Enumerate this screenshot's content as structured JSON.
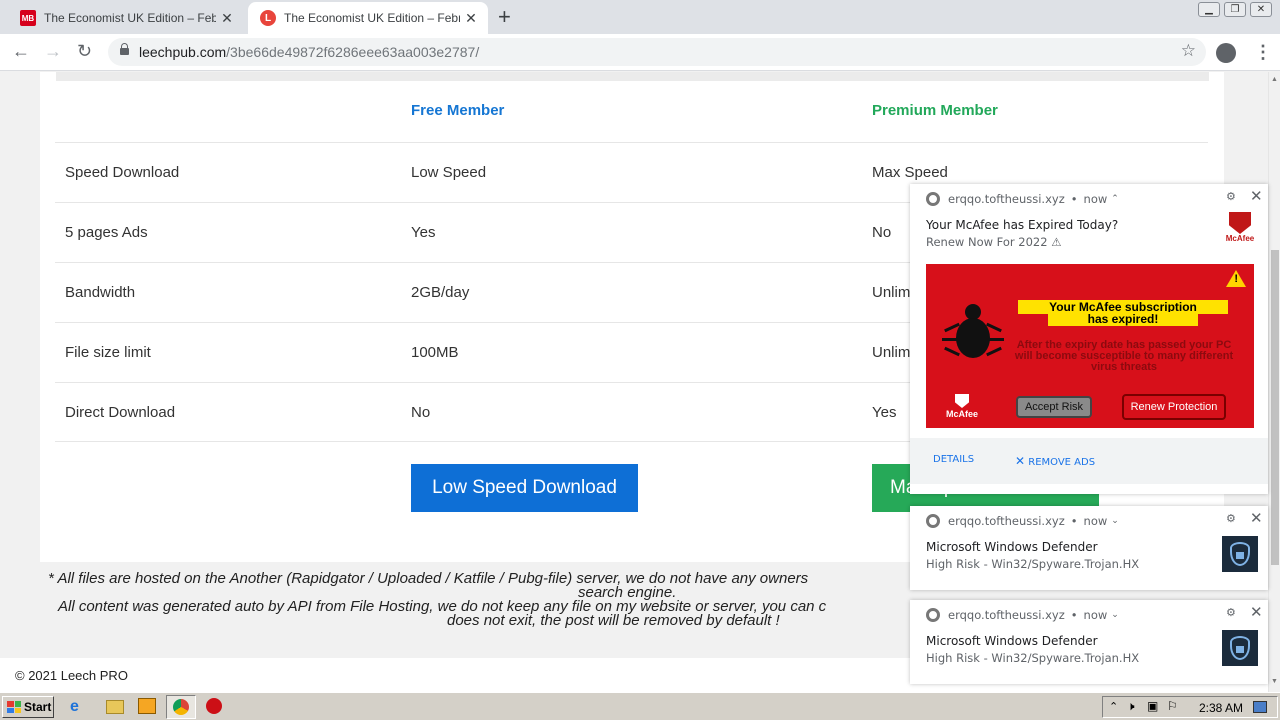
{
  "browser": {
    "tabs": [
      {
        "favicon": "MB",
        "title": "The Economist UK Edition – February"
      },
      {
        "favicon": "L",
        "title": "The Economist UK Edition – February"
      }
    ],
    "url_host": "leechpub.com",
    "url_path": "/3be66de49872f6286eee63aa003e2787/"
  },
  "table": {
    "headers": [
      "Free Member",
      "Premium Member"
    ],
    "rows": [
      [
        "Speed Download",
        "Low Speed",
        "Max Speed"
      ],
      [
        "5 pages Ads",
        "Yes",
        "No"
      ],
      [
        "Bandwidth",
        "2GB/day",
        "Unlim"
      ],
      [
        "File size limit",
        "100MB",
        "Unlim"
      ],
      [
        "Direct Download",
        "No",
        "Yes"
      ]
    ],
    "low_button": "Low Speed Download",
    "max_button": "Max Speed Download"
  },
  "notes": {
    "line1": "* All files are hosted on the Another (Rapidgator / Uploaded / Katfile / Pubg-file) server, we do not have any owners",
    "line1b": "search engine.",
    "line2": "All content was generated auto by API from File Hosting, we do not keep any file on my website or server, you can c",
    "line2b": "does not exit, the post will be removed by default !"
  },
  "footer": "© 2021 Leech PRO",
  "notifications": [
    {
      "source": "erqqo.toftheussi.xyz",
      "time": "now",
      "title": "Your McAfee has Expired Today?",
      "message": "Renew Now For 2022 ⚠",
      "icon_label": "McAfee",
      "banner": {
        "title1": "Your McAfee subscription",
        "title2": "has expired!",
        "body": "After the expiry date has passed your PC will become susceptible to many different virus threats",
        "logo": "McAfee",
        "accept": "Accept Risk",
        "renew": "Renew Protection"
      },
      "actions": [
        "DETAILS",
        "REMOVE ADS"
      ]
    },
    {
      "source": "erqqo.toftheussi.xyz",
      "time": "now",
      "title": "Microsoft Windows Defender",
      "message": "High Risk - Win32/Spyware.Trojan.HX"
    },
    {
      "source": "erqqo.toftheussi.xyz",
      "time": "now",
      "title": "Microsoft Windows Defender",
      "message": "High Risk - Win32/Spyware.Trojan.HX"
    }
  ],
  "taskbar": {
    "start": "Start",
    "clock": "2:38 AM"
  }
}
